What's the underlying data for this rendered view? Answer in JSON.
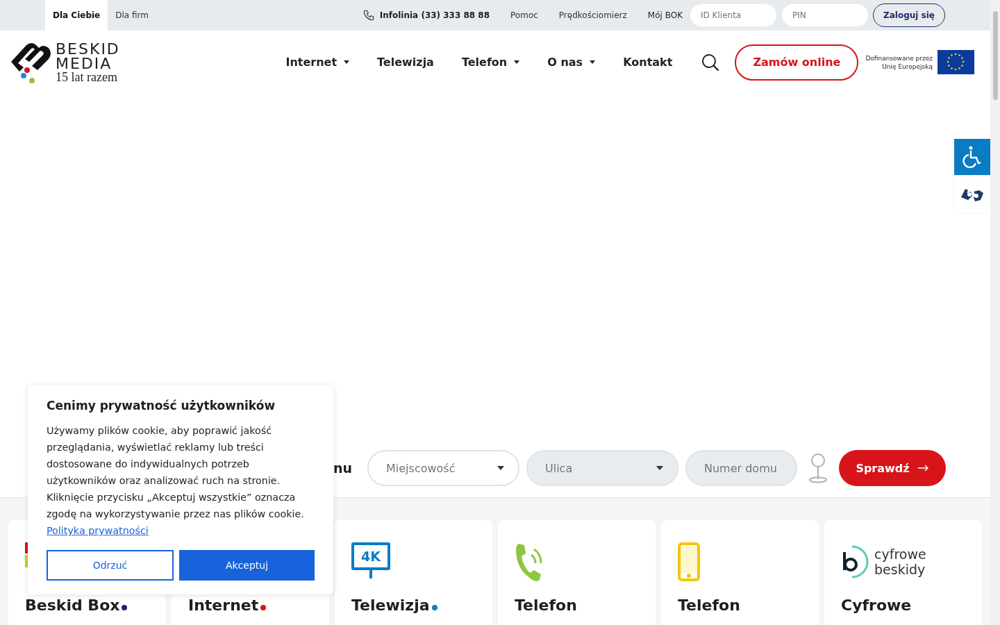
{
  "top_bar": {
    "segments": [
      {
        "label": "Dla Ciebie",
        "selected": true
      },
      {
        "label": "Dla firm",
        "selected": false
      }
    ],
    "hotline": "Infolinia (33) 333 88 88",
    "links": [
      "Pomoc",
      "Prędkościomierz"
    ],
    "bok_label": "Mój BOK",
    "login": {
      "id_placeholder": "ID Klienta",
      "pin_placeholder": "PIN",
      "button": "Zaloguj się"
    }
  },
  "header": {
    "logo": {
      "line1": "BESKID",
      "line2": "MEDIA",
      "tagline": "15 lat razem"
    },
    "nav": [
      {
        "label": "Internet",
        "has_dropdown": true
      },
      {
        "label": "Telewizja",
        "has_dropdown": false
      },
      {
        "label": "Telefon",
        "has_dropdown": true
      },
      {
        "label": "O nas",
        "has_dropdown": true
      },
      {
        "label": "Kontakt",
        "has_dropdown": false
      }
    ],
    "order_button": "Zamów online",
    "eu_note": [
      "Dofinansowane przez",
      "Unię Europejską"
    ]
  },
  "address_search": {
    "label_fragment": "nu",
    "fields": [
      {
        "kind": "select",
        "placeholder": "Miejscowość",
        "disabled": false
      },
      {
        "kind": "select",
        "placeholder": "Ulica",
        "disabled": true
      },
      {
        "kind": "input",
        "placeholder": "Numer domu",
        "disabled": true
      }
    ],
    "button": "Sprawdź"
  },
  "cards": [
    {
      "title": "Beskid Box",
      "color": "#1b2a5e",
      "kind": "box"
    },
    {
      "title": "Internet",
      "color": "#d7141a",
      "kind": "hidden"
    },
    {
      "title": "Telewizja",
      "color": "#0a7cc4",
      "kind": "tv",
      "badge": "4K"
    },
    {
      "title": "Telefon",
      "kind": "landline"
    },
    {
      "title": "Telefon",
      "kind": "mobile"
    },
    {
      "title": "Cyfrowe",
      "kind": "logo",
      "logo_text": [
        "cyfrowe",
        "beskidy"
      ]
    }
  ],
  "cookie": {
    "title": "Cenimy prywatność użytkowników",
    "body": "Używamy plików cookie, aby poprawić jakość przeglądania, wyświetlać reklamy lub treści dostosowane do indywidualnych potrzeb użytkowników oraz analizować ruch na stronie. Kliknięcie przycisku „Akceptuj wszystkie” oznacza zgodę na wykorzystywanie przez nas plików cookie.",
    "link": "Polityka prywatności",
    "reject": "Odrzuć",
    "accept": "Akceptuj"
  }
}
